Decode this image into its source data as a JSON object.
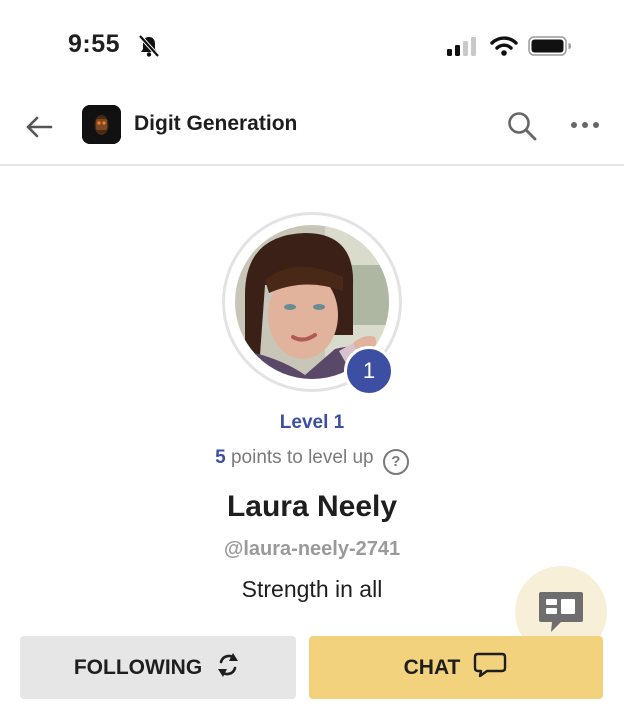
{
  "status_bar": {
    "time": "9:55"
  },
  "header": {
    "title": "Digit Generation"
  },
  "profile": {
    "level_badge": "1",
    "level_text": "Level 1",
    "points_number": "5",
    "points_suffix": "points to level up",
    "help_symbol": "?",
    "name": "Laura Neely",
    "handle": "@laura-neely-2741",
    "bio": "Strength in all"
  },
  "buttons": {
    "following_label": "FOLLOWING",
    "chat_label": "CHAT"
  },
  "colors": {
    "accent": "#3d4fa3",
    "chat_button": "#f3d27e",
    "following_button": "#e6e6e6"
  },
  "icons": [
    "bell-slash-icon",
    "signal-icon",
    "wifi-icon",
    "battery-icon",
    "back-arrow-icon",
    "search-icon",
    "more-icon",
    "help-icon",
    "refresh-icon",
    "chat-bubble-icon",
    "floating-chat-icon"
  ]
}
